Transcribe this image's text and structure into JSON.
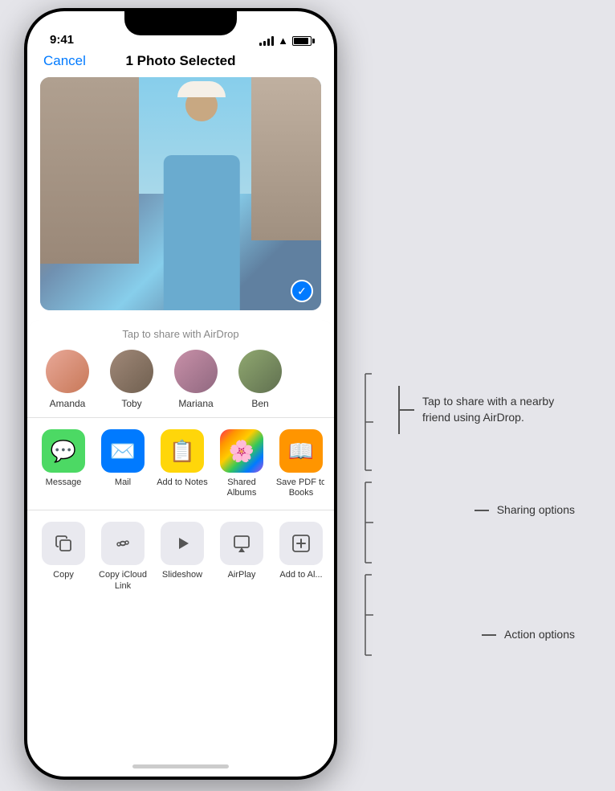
{
  "scene": {
    "background_color": "#e5e5ea"
  },
  "status_bar": {
    "time": "9:41",
    "signal_label": "signal",
    "wifi_label": "wifi",
    "battery_label": "battery"
  },
  "nav": {
    "cancel_label": "Cancel",
    "title": "1 Photo Selected"
  },
  "photo": {
    "alt": "Woman in blue dress with hat on a European street balcony",
    "checkmark": "✓"
  },
  "airdrop": {
    "label": "Tap to share with AirDrop",
    "contacts": [
      {
        "name": "Amanda",
        "avatar_class": "avatar-amanda"
      },
      {
        "name": "Toby",
        "avatar_class": "avatar-toby"
      },
      {
        "name": "Mariana",
        "avatar_class": "avatar-mariana"
      },
      {
        "name": "Ben",
        "avatar_class": "avatar-ben"
      }
    ]
  },
  "apps": [
    {
      "name": "Message",
      "icon": "💬",
      "class": "app-message"
    },
    {
      "name": "Mail",
      "icon": "✉️",
      "class": "app-mail"
    },
    {
      "name": "Add to Notes",
      "icon": "📋",
      "class": "app-notes"
    },
    {
      "name": "Shared Albums",
      "icon": "🌸",
      "class": "app-photos"
    },
    {
      "name": "Save PDF to Books",
      "icon": "📖",
      "class": "app-books"
    }
  ],
  "actions": [
    {
      "name": "Copy",
      "icon": "⧉"
    },
    {
      "name": "Copy iCloud Link",
      "icon": "🔗"
    },
    {
      "name": "Slideshow",
      "icon": "▶"
    },
    {
      "name": "AirPlay",
      "icon": "⬛"
    },
    {
      "name": "Add to Al...",
      "icon": "+"
    }
  ],
  "annotations": [
    {
      "id": "airdrop-annotation",
      "text": "Tap to share with a nearby friend using AirDrop.",
      "top_pct": 52
    },
    {
      "id": "sharing-annotation",
      "text": "Sharing options",
      "top_pct": 67
    },
    {
      "id": "action-annotation",
      "text": "Action options",
      "top_pct": 82
    }
  ]
}
